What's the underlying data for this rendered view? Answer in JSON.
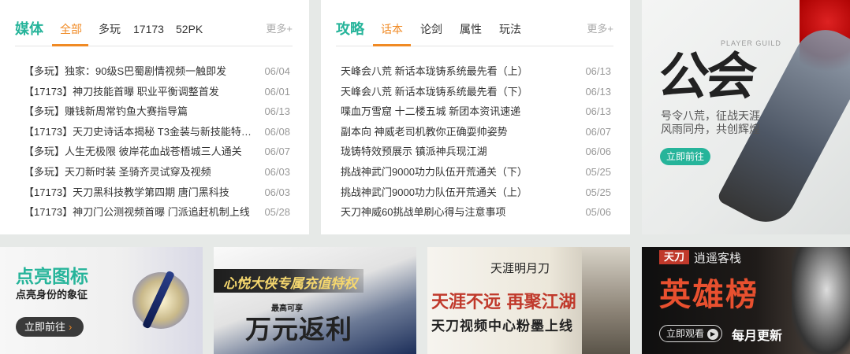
{
  "media": {
    "title": "媒体",
    "tabs": [
      "全部",
      "多玩",
      "17173",
      "52PK"
    ],
    "active_tab": "全部",
    "more": "更多+",
    "news": [
      {
        "title": "【多玩】独家：90级S巴蜀剧情视频一触即发",
        "date": "06/04"
      },
      {
        "title": "【17173】神刀技能首曝 职业平衡调整首发",
        "date": "06/01"
      },
      {
        "title": "【多玩】赚钱新周常钓鱼大赛指导篇",
        "date": "06/13"
      },
      {
        "title": "【17173】天刀史诗话本揭秘 T3金装与新技能特…",
        "date": "06/08"
      },
      {
        "title": "【多玩】人生无极限 彼岸花血战苍梧城三人通关",
        "date": "06/07"
      },
      {
        "title": "【多玩】天刀新时装 圣骑齐灵试穿及视频",
        "date": "06/03"
      },
      {
        "title": "【17173】天刀黑科技教学第四期 唐门黑科技",
        "date": "06/03"
      },
      {
        "title": "【17173】神刀门公测视频首曝 门派追赶机制上线",
        "date": "05/28"
      }
    ]
  },
  "guide": {
    "title": "攻略",
    "tabs": [
      "话本",
      "论剑",
      "属性",
      "玩法"
    ],
    "active_tab": "话本",
    "more": "更多+",
    "news": [
      {
        "title": "天峰会八荒 新话本珑铸系统最先看（上）",
        "date": "06/13"
      },
      {
        "title": "天峰会八荒 新话本珑铸系统最先看（下）",
        "date": "06/13"
      },
      {
        "title": "喋血万雪窟 十二楼五城 新团本资讯速递",
        "date": "06/13"
      },
      {
        "title": "副本向 神威老司机教你正确耍帅姿势",
        "date": "06/07"
      },
      {
        "title": "珑铸特效预展示 镇派神兵现江湖",
        "date": "06/06"
      },
      {
        "title": "挑战神武门9000功力队伍开荒通关（下）",
        "date": "05/25"
      },
      {
        "title": "挑战神武门9000功力队伍开荒通关（上）",
        "date": "05/25"
      },
      {
        "title": "天刀神威60挑战单刷心得与注意事项",
        "date": "05/06"
      }
    ]
  },
  "guild": {
    "tag": "PLAYER GUILD",
    "big_text": "公会",
    "line1": "号令八荒，征战天涯",
    "line2": "风雨同舟，共创辉煌",
    "button": "立即前往"
  },
  "banners": {
    "icon": {
      "title": "点亮图标",
      "subtitle": "点亮身份的象征",
      "button": "立即前往",
      "arrow": "›"
    },
    "recharge": {
      "title": "心悦大侠专属充值特权",
      "small": "最高可享",
      "big": "万元返利"
    },
    "video": {
      "logo": "天涯明月刀",
      "line1": "天涯不远 再聚江湖",
      "line2": "天刀视频中心粉墨上线"
    },
    "heroes": {
      "logo": "天刀",
      "subtitle": "逍遥客栈",
      "title": "英雄榜",
      "watch": "立即观看",
      "play": "▶",
      "monthly": "每月更新"
    }
  }
}
